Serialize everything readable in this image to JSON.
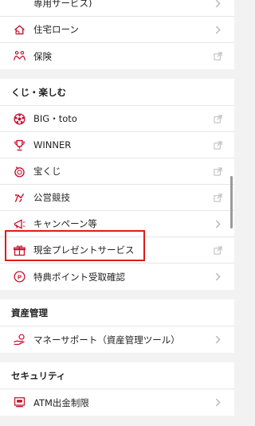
{
  "colors": {
    "accent": "#c8102e",
    "highlight": "#e01b1b",
    "chevron": "#b5b5b5"
  },
  "top_group": {
    "items": [
      {
        "label": "専用サービス)",
        "trailing": "chevron-right-icon",
        "icon": "none"
      },
      {
        "label": "住宅ローン",
        "trailing": "chevron-right-icon",
        "icon": "house-loan-icon"
      },
      {
        "label": "保険",
        "trailing": "external-link-icon",
        "icon": "insurance-icon"
      }
    ]
  },
  "fun_section": {
    "title": "くじ・楽しむ",
    "items": [
      {
        "label": "BIG・toto",
        "trailing": "external-link-icon",
        "icon": "soccer-ball-icon"
      },
      {
        "label": "WINNER",
        "trailing": "external-link-icon",
        "icon": "trophy-icon"
      },
      {
        "label": "宝くじ",
        "trailing": "external-link-icon",
        "icon": "lottery-icon"
      },
      {
        "label": "公営競技",
        "trailing": "external-link-icon",
        "icon": "racing-icon"
      },
      {
        "label": "キャンペーン等",
        "trailing": "chevron-right-icon",
        "icon": "megaphone-icon"
      },
      {
        "label": "現金プレゼントサービス",
        "trailing": "external-link-icon",
        "icon": "gift-icon"
      },
      {
        "label": "特典ポイント受取確認",
        "trailing": "chevron-right-icon",
        "icon": "points-icon"
      }
    ]
  },
  "asset_section": {
    "title": "資産管理",
    "items": [
      {
        "label": "マネーサポート（資産管理ツール）",
        "trailing": "chevron-right-icon",
        "icon": "money-support-icon"
      }
    ]
  },
  "security_section": {
    "title": "セキュリティ",
    "items": [
      {
        "label": "ATM出金制限",
        "trailing": "chevron-right-icon",
        "icon": "atm-icon"
      }
    ]
  }
}
